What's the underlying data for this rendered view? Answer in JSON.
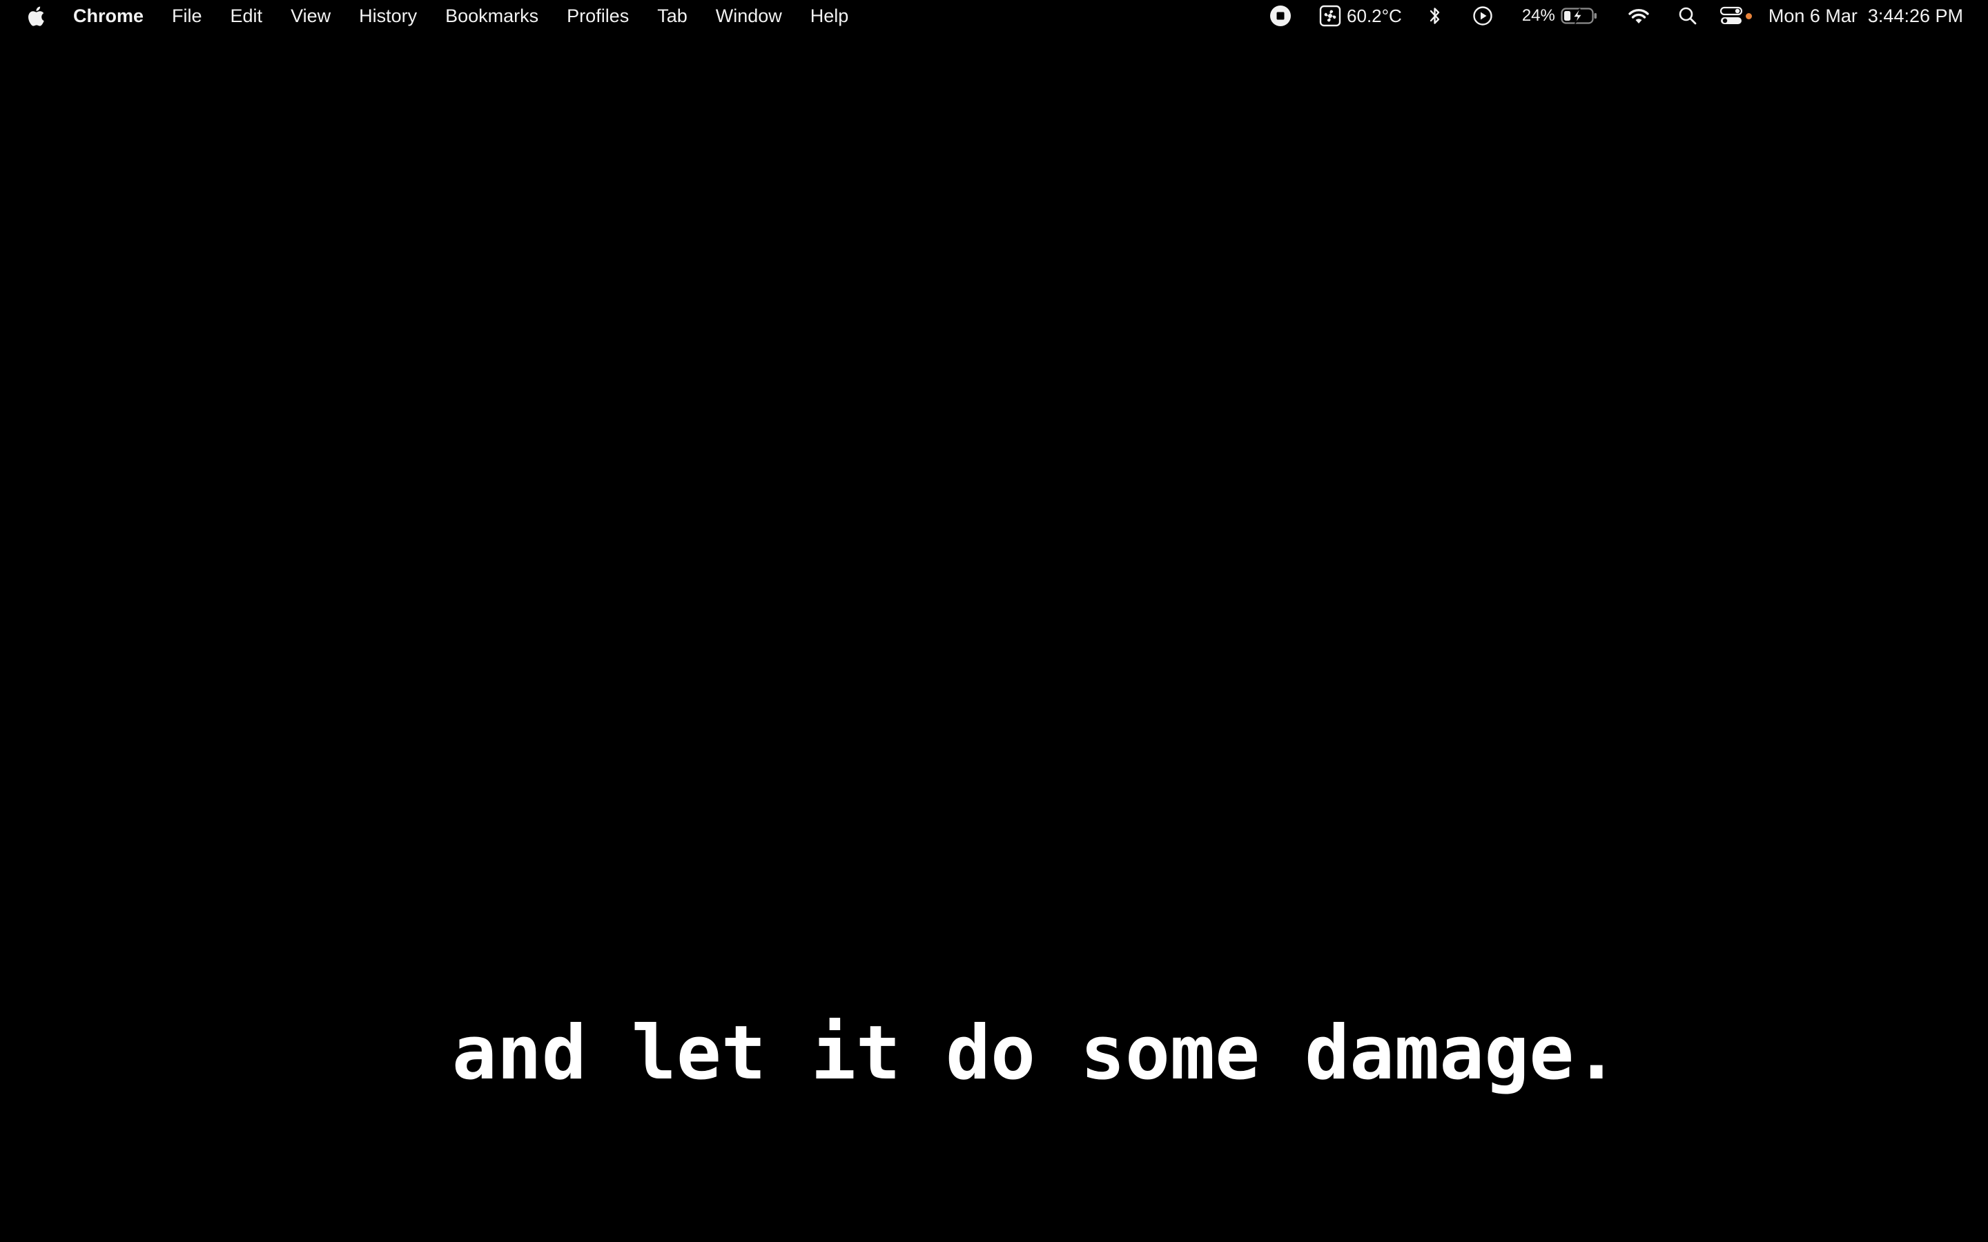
{
  "menubar": {
    "apple_icon": "apple-logo-icon",
    "app_name": "Chrome",
    "items": [
      "File",
      "Edit",
      "View",
      "History",
      "Bookmarks",
      "Profiles",
      "Tab",
      "Window",
      "Help"
    ],
    "status": {
      "record_icon": "stop-record-icon",
      "fan_icon": "fan-temperature-icon",
      "temperature": "60.2°C",
      "bluetooth_icon": "bluetooth-icon",
      "play_icon": "play-circle-icon",
      "battery_percent": "24%",
      "battery_icon": "battery-charging-icon",
      "battery_level": 0.24,
      "wifi_icon": "wifi-icon",
      "search_icon": "spotlight-search-icon",
      "control_center_icon": "control-center-icon",
      "mic_indicator_color": "#e8833a",
      "date": "Mon 6 Mar",
      "time": "3:44:26 PM"
    }
  },
  "caption": {
    "text": "and let it do some damage."
  },
  "colors": {
    "background": "#000000",
    "text": "#ffffff",
    "indicator": "#e8833a"
  }
}
